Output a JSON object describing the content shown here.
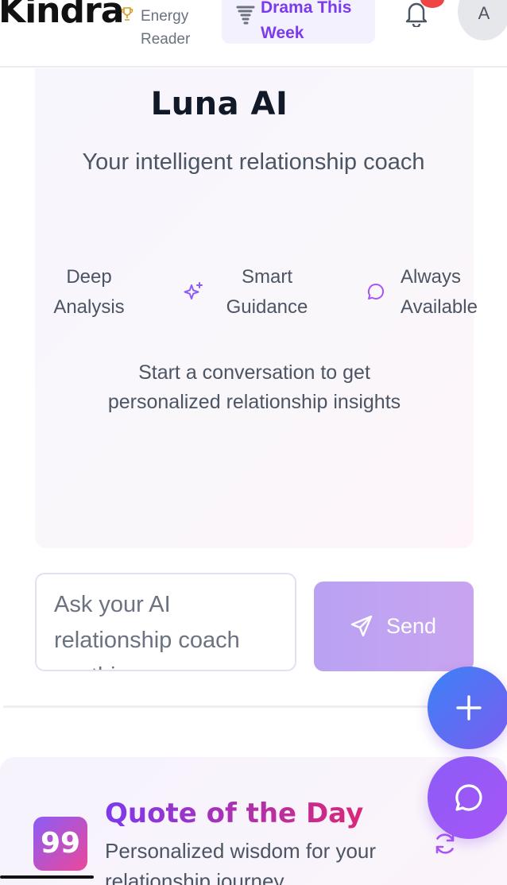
{
  "header": {
    "brand": "Kindra",
    "energy_line1": "Energy",
    "energy_line2": "Reader",
    "drama_line1": "Drama This",
    "drama_line2": "Week",
    "avatar_letter": "A"
  },
  "luna": {
    "title": "Luna AI",
    "subtitle": "Your intelligent relationship coach",
    "features": [
      {
        "line1": "Deep",
        "line2": "Analysis",
        "icon": "none"
      },
      {
        "line1": "Smart",
        "line2": "Guidance",
        "icon": "sparkle-icon"
      },
      {
        "line1": "Always",
        "line2": "Available",
        "icon": "chat-bubble-icon"
      }
    ],
    "start_text": "Start a conversation to get personalized relationship insights"
  },
  "composer": {
    "placeholder": "Ask your AI relationship coach anything...",
    "send_label": "Send"
  },
  "quote": {
    "title": "Quote of the Day",
    "subtitle": "Personalized wisdom for your relationship journey"
  },
  "colors": {
    "accent": "#7c3aed",
    "accent_pink": "#db2777",
    "notification": "#ef4444"
  }
}
